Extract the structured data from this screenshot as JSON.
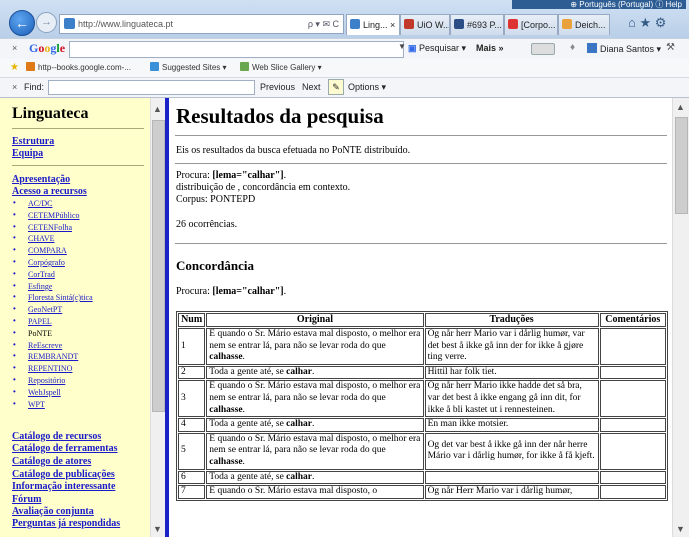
{
  "browser": {
    "address_url": "http://www.linguateca.pt",
    "address_tools": "ρ ▾ ✉ C",
    "tabs": [
      {
        "label": "Ling... ×",
        "active": true,
        "color": "#3e7fc9"
      },
      {
        "label": "UiO W...",
        "active": false,
        "color": "#c0392b"
      },
      {
        "label": "#693 P...",
        "active": false,
        "color": "#2b4e86"
      },
      {
        "label": "[Corpo...",
        "active": false,
        "color": "#d33"
      },
      {
        "label": "Deich...",
        "active": false,
        "color": "#e9a23b"
      }
    ],
    "tooltip": "⊕ Português (Portugal)  ⓘ Help"
  },
  "google_toolbar": {
    "logo": "Google",
    "search_button": "Pesquisar ▾",
    "more_label": "Mais »",
    "user_name": "Diana Santos ▾"
  },
  "favorites_bar": {
    "items": [
      {
        "label": "http--books.google.com-...",
        "color": "#e07a18"
      },
      {
        "label": "Suggested Sites ▾",
        "color": "#3a8fd9"
      },
      {
        "label": "Web Slice Gallery ▾",
        "color": "#6aa84f"
      }
    ]
  },
  "find_bar": {
    "close": "×",
    "label": "Find:",
    "value": "",
    "previous": "Previous",
    "next": "Next",
    "options": "Options ▾"
  },
  "sidebar": {
    "title": "Linguateca",
    "group1": [
      "Estrutura",
      "Equipa"
    ],
    "group2": [
      "Apresentação",
      "Acesso a recursos"
    ],
    "resources": [
      {
        "label": "AC/DC",
        "link": true
      },
      {
        "label": "CETEMPúblico",
        "link": true
      },
      {
        "label": "CETENFolha",
        "link": true
      },
      {
        "label": "CHAVE",
        "link": true
      },
      {
        "label": "COMPARA",
        "link": true
      },
      {
        "label": "Corpógrafo",
        "link": true
      },
      {
        "label": "CorTrad",
        "link": true
      },
      {
        "label": "Esfinge",
        "link": true
      },
      {
        "label": "Floresta Sintá(c)tica",
        "link": true
      },
      {
        "label": "GeoNetPT",
        "link": true
      },
      {
        "label": "PAPEL",
        "link": true
      },
      {
        "label": "PoNTE",
        "link": false
      },
      {
        "label": "ReEscreve",
        "link": true
      },
      {
        "label": "REMBRANDT",
        "link": true
      },
      {
        "label": "REPENTINO",
        "link": true
      },
      {
        "label": "Repositório",
        "link": true
      },
      {
        "label": "WebJspell",
        "link": true
      },
      {
        "label": "WPT",
        "link": true
      }
    ],
    "group3": [
      "Catálogo de recursos",
      "Catálogo de ferramentas",
      "Catálogo de atores",
      "Catálogo de publicações",
      "Informação interessante",
      "Fórum",
      "Avaliação conjunta",
      "Perguntas já respondidas"
    ]
  },
  "main": {
    "heading": "Resultados da pesquisa",
    "intro": "Eis os resultados da busca efetuada no PoNTE distribuído.",
    "query_prefix": "Procura: ",
    "query": "[lema=\"calhar\"]",
    "query_suffix": ".",
    "distribution": "distribuição de , concordância em contexto.",
    "corpus": "Corpus: PONTEPD",
    "occurrences": "26 ocorrências.",
    "section_heading": "Concordância",
    "table": {
      "headers": [
        "Num",
        "Original",
        "Traduções",
        "Comentários"
      ],
      "rows": [
        {
          "num": "1",
          "orig_pre": "E quando o Sr. Mário estava mal disposto, o melhor era nem se entrar lá, para não se levar roda do que ",
          "orig_hit": "calhasse",
          "orig_post": ".",
          "trad": "Og når herr Mario var i dårlig humør, var det best å ikke gå inn der for ikke å gjøre ting verre."
        },
        {
          "num": "2",
          "orig_pre": "Toda a gente até, se ",
          "orig_hit": "calhar",
          "orig_post": ".",
          "trad": "Hittil har folk tiet."
        },
        {
          "num": "3",
          "orig_pre": "E quando o Sr. Mário estava mal disposto, o melhor era nem se entrar lá, para não se levar roda do que ",
          "orig_hit": "calhasse",
          "orig_post": ".",
          "trad": "Og når herr Mario ikke hadde det så bra, var det best å ikke engang gå inn dit, for ikke å bli kastet ut i rennesteinen."
        },
        {
          "num": "4",
          "orig_pre": "Toda a gente até, se ",
          "orig_hit": "calhar",
          "orig_post": ".",
          "trad": "En man ikke motsier."
        },
        {
          "num": "5",
          "orig_pre": "E quando o Sr. Mário estava mal disposto, o melhor era nem se entrar lá, para não se levar roda do que ",
          "orig_hit": "calhasse",
          "orig_post": ".",
          "trad": "Og det var best å ikke gå inn der når herre Mário var i dårlig humør, for ikke å få kjeft."
        },
        {
          "num": "6",
          "orig_pre": "Toda a gente até, se ",
          "orig_hit": "calhar",
          "orig_post": ".",
          "trad": ""
        },
        {
          "num": "7",
          "orig_pre": "E quando o Sr. Mário estava mal disposto, o",
          "orig_hit": "",
          "orig_post": "",
          "trad": "Og når Herr Mario var i dårlig humør,"
        }
      ]
    }
  }
}
